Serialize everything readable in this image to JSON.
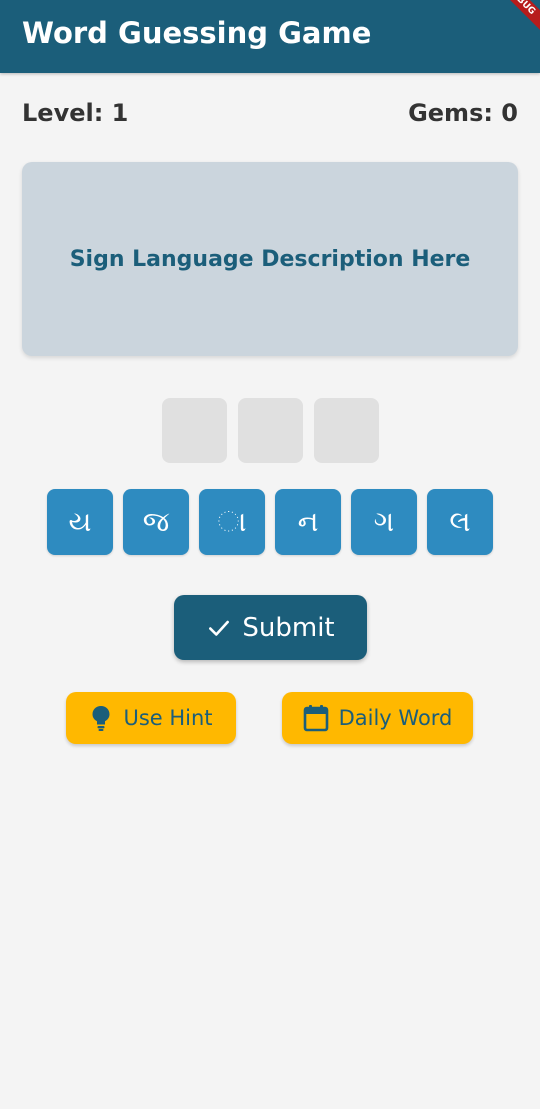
{
  "appbar": {
    "title": "Word Guessing Game",
    "debug_banner": "DEBUG",
    "color": "#1b5e7a"
  },
  "stats": {
    "level": "Level: 1",
    "gems": "Gems: 0"
  },
  "description": {
    "text": "Sign Language Description Here"
  },
  "answer_slots": [
    "",
    "",
    ""
  ],
  "letters": [
    "ય",
    "જ",
    "ા",
    "ન",
    "ગ",
    "લ"
  ],
  "actions": {
    "submit_label": "Submit",
    "hint_label": "Use Hint",
    "daily_label": "Daily Word"
  },
  "colors": {
    "primary": "#1b5e7a",
    "letter_tile": "#2e8bc0",
    "accent": "#ffb800",
    "card": "#cbd5dd",
    "slot": "#e0e0e0"
  }
}
